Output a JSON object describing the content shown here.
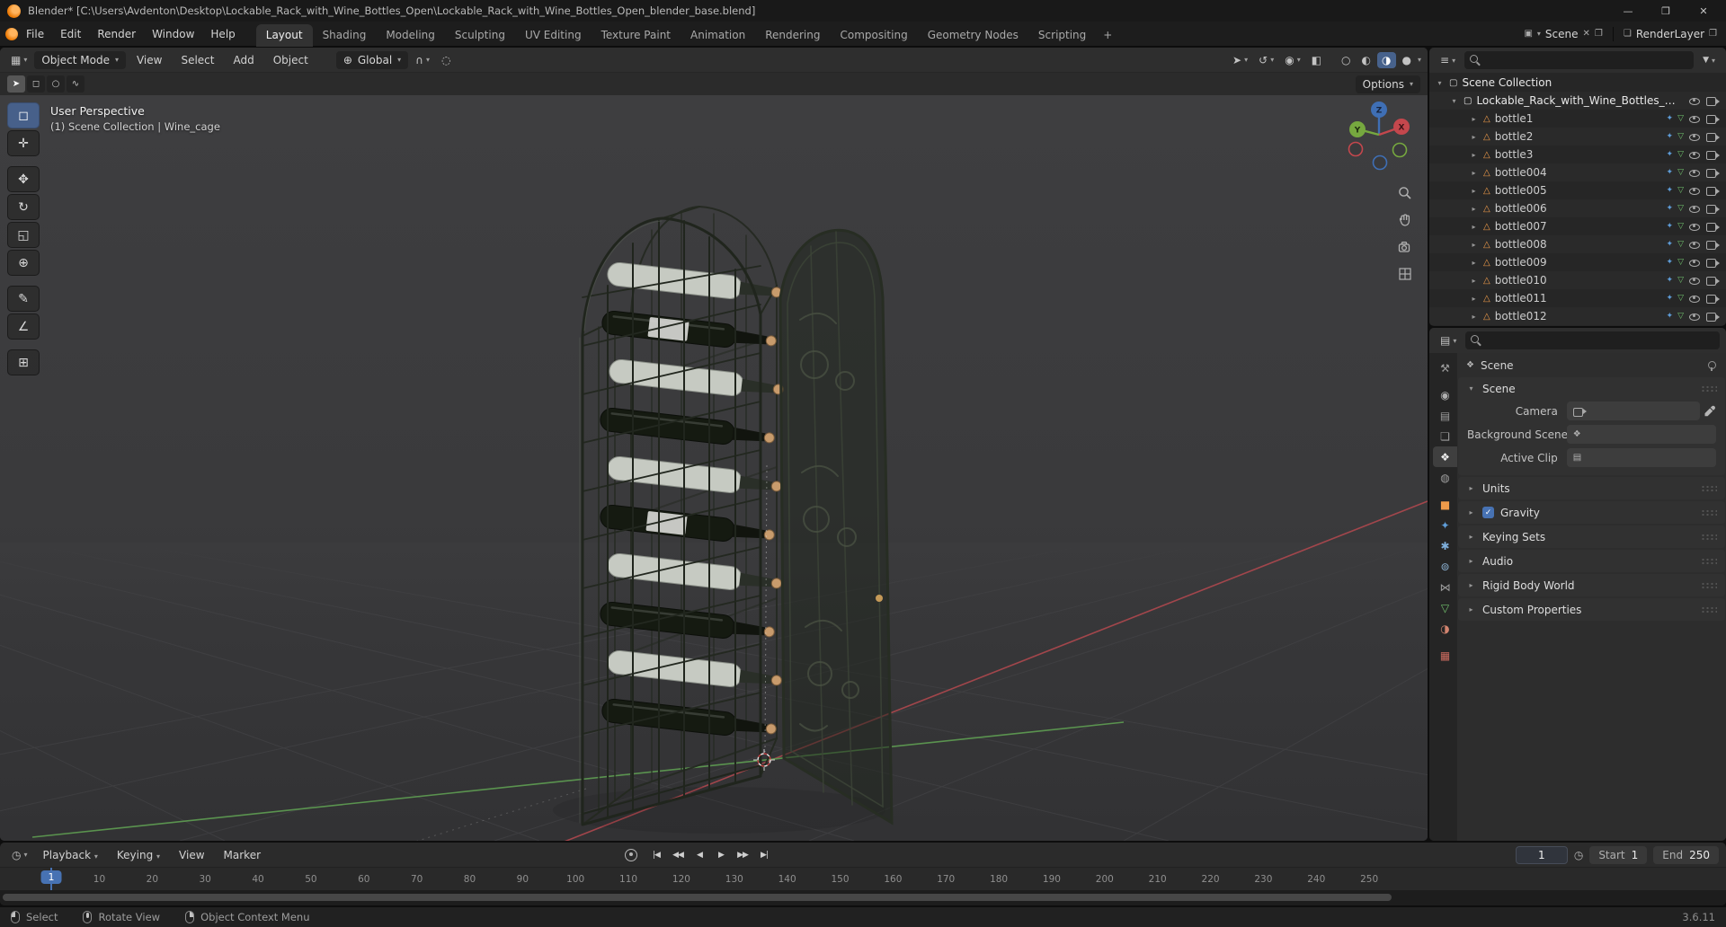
{
  "window": {
    "title": "Blender* [C:\\Users\\Avdenton\\Desktop\\Lockable_Rack_with_Wine_Bottles_Open\\Lockable_Rack_with_Wine_Bottles_Open_blender_base.blend]",
    "minimize": "—",
    "maximize": "❐",
    "close": "✕"
  },
  "colors": {
    "accent": "#4772b3",
    "object_orange": "#ef9b4a",
    "mesh_green": "#71c16d",
    "modifier_blue": "#5f9dd8",
    "axis_x": "#c4474d",
    "axis_y": "#76a83f",
    "axis_z": "#3f6fb5"
  },
  "topbar": {
    "menus": [
      "File",
      "Edit",
      "Render",
      "Window",
      "Help"
    ],
    "workspace_active": "Layout",
    "workspaces_rest": [
      "Shading",
      "Modeling",
      "Sculpting",
      "UV Editing",
      "Texture Paint",
      "Animation",
      "Rendering",
      "Compositing",
      "Geometry Nodes",
      "Scripting"
    ],
    "add_workspace": "+",
    "scene": "Scene",
    "view_layer": "RenderLayer"
  },
  "icons": {
    "viewport_editor": "▦",
    "outliner_editor": "≡",
    "properties_editor": "▤",
    "timeline_editor": "◷",
    "globe": "⊕",
    "magnet": "∩",
    "proportional": "◌",
    "pointer": "➤",
    "gizmo_toggle": "↺",
    "overlays": "◉",
    "xray": "◧",
    "shading_wire": "○",
    "shading_solid": "◐",
    "shading_material": "◑",
    "shading_rendered": "●",
    "collection": "▢",
    "mesh_object": "△",
    "modifier_badge": "✦",
    "meshdata_badge": "▽",
    "scene_glyph": "❖",
    "funnel": "▼",
    "clock": "◷",
    "clip": "▤",
    "selmode_tweak": "➤",
    "selmode_box": "◻",
    "selmode_circle": "○",
    "selmode_lasso": "∿",
    "scene_dup": "❐",
    "layer_stack": "❏",
    "unlink": "✕",
    "scene_box": "▣"
  },
  "viewport": {
    "header": {
      "mode": "Object Mode",
      "menus": [
        "View",
        "Select",
        "Add",
        "Object"
      ],
      "orientation": "Global"
    },
    "tool_settings": {
      "options": "Options"
    },
    "overlay": {
      "line1": "User Perspective",
      "line2": "(1) Scene Collection | Wine_cage"
    },
    "tools": [
      {
        "name": "select-box",
        "glyph": "◻"
      },
      {
        "name": "cursor",
        "glyph": "✛"
      },
      {
        "name": "move",
        "glyph": "✥"
      },
      {
        "name": "rotate",
        "glyph": "↻"
      },
      {
        "name": "scale",
        "glyph": "◱"
      },
      {
        "name": "transform",
        "glyph": "⊕"
      },
      {
        "name": "annotate",
        "glyph": "✎"
      },
      {
        "name": "measure",
        "glyph": "∠"
      },
      {
        "name": "add-cube",
        "glyph": "⊞"
      }
    ],
    "gizmo": {
      "x": "X",
      "y": "Y",
      "z": "Z"
    }
  },
  "outliner": {
    "scene_collection": "Scene Collection",
    "collection": "Lockable_Rack_with_Wine_Bottles_Ope",
    "objects": [
      "bottle1",
      "bottle2",
      "bottle3",
      "bottle004",
      "bottle005",
      "bottle006",
      "bottle007",
      "bottle008",
      "bottle009",
      "bottle010",
      "bottle011",
      "bottle012"
    ]
  },
  "properties": {
    "breadcrumb": "Scene",
    "tabs": [
      {
        "name": "tool",
        "glyph": "⚒"
      },
      {
        "name": "render",
        "glyph": "◉"
      },
      {
        "name": "output",
        "glyph": "▤"
      },
      {
        "name": "view-layer",
        "glyph": "❏"
      },
      {
        "name": "scene",
        "glyph": "❖"
      },
      {
        "name": "world",
        "glyph": "◍"
      },
      {
        "name": "object",
        "glyph": "■"
      },
      {
        "name": "modifiers",
        "glyph": "✦"
      },
      {
        "name": "particles",
        "glyph": "✱"
      },
      {
        "name": "physics",
        "glyph": "⊚"
      },
      {
        "name": "constraints",
        "glyph": "⋈"
      },
      {
        "name": "object-data",
        "glyph": "▽"
      },
      {
        "name": "material",
        "glyph": "◑"
      },
      {
        "name": "texture",
        "glyph": "▦"
      }
    ],
    "scene_panel": {
      "title": "Scene",
      "fields": [
        {
          "label": "Camera"
        },
        {
          "label": "Background Scene"
        },
        {
          "label": "Active Clip"
        }
      ]
    },
    "collapsed_panels": [
      {
        "label": "Units"
      },
      {
        "label": "Gravity",
        "checkbox": true
      },
      {
        "label": "Keying Sets"
      },
      {
        "label": "Audio"
      },
      {
        "label": "Rigid Body World"
      },
      {
        "label": "Custom Properties"
      }
    ]
  },
  "timeline": {
    "menus": [
      "Playback",
      "Keying",
      "View",
      "Marker"
    ],
    "current_frame": "1",
    "start_label": "Start",
    "start_value": "1",
    "end_label": "End",
    "end_value": "250",
    "ticks": [
      10,
      20,
      30,
      40,
      50,
      60,
      70,
      80,
      90,
      100,
      110,
      120,
      130,
      140,
      150,
      160,
      170,
      180,
      190,
      200,
      210,
      220,
      230,
      240,
      250
    ]
  },
  "statusbar": {
    "items": [
      {
        "label": "Select",
        "button": "left"
      },
      {
        "label": "Rotate View",
        "button": "middle"
      },
      {
        "label": "Object Context Menu",
        "button": "right"
      }
    ],
    "version": "3.6.11"
  }
}
